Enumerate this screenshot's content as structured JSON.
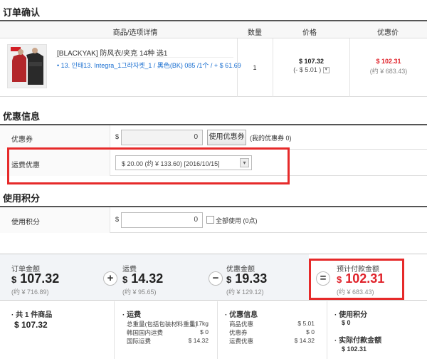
{
  "order": {
    "title": "订单确认",
    "headers": {
      "product": "商品/选项详情",
      "qty": "数量",
      "price": "价格",
      "discount_price": "优惠价"
    },
    "item": {
      "name": "[BLACKYAK] 防风衣/夹克 14种 选1",
      "option": "• 13. 인태13. Integra_1그라자켓_1 / 黑色(BK) 085 /1个 / + $ 61.69",
      "qty": "1",
      "price": "$ 107.32",
      "price_sub": "(- $ 5.01 )",
      "discount_price": "$ 102.31",
      "discount_sub": "(约 ¥ 683.43)"
    }
  },
  "promo": {
    "title": "优惠信息",
    "coupon_label": "优惠券",
    "coupon_currency": "$",
    "coupon_value": "0",
    "coupon_button": "使用优惠券",
    "my_coupons": "(我的优惠券 0)",
    "shipping_label": "运费优惠",
    "shipping_option": "$ 20.00 (约 ¥ 133.60) [2016/10/15]"
  },
  "points": {
    "title": "使用积分",
    "label": "使用积分",
    "currency": "$",
    "value": "0",
    "use_all": "全部使用",
    "points_info": "(0点)"
  },
  "summary": {
    "order_total_label": "订单金额",
    "order_total_cur": "$",
    "order_total": "107.32",
    "order_total_sub": "(约 ¥ 716.89)",
    "shipping_label": "运费",
    "shipping_cur": "$",
    "shipping": "14.32",
    "shipping_sub": "(约 ¥ 95.65)",
    "discount_label": "优惠金额",
    "discount_cur": "$",
    "discount": "19.33",
    "discount_sub": "(约 ¥ 129.12)",
    "pay_label": "预计付款金额",
    "pay_cur": "$",
    "pay": "102.31",
    "pay_sub": "(约 ¥ 683.43)",
    "plus": "+",
    "minus": "−",
    "equals": "="
  },
  "details": {
    "items_label": "· 共 1 件商品",
    "items_total": "$ 107.32",
    "ship_title": "· 运费",
    "ship_rows": [
      {
        "k": "总重量(包括包装材料重量)",
        "v": "1.17kg"
      },
      {
        "k": "韩国国内运费",
        "v": "$ 0"
      },
      {
        "k": "国际运费",
        "v": "$ 14.32"
      }
    ],
    "disc_title": "· 优惠信息",
    "disc_rows": [
      {
        "k": "商品优惠",
        "v": "$ 5.01"
      },
      {
        "k": "优惠券",
        "v": "$ 0"
      },
      {
        "k": "运费优惠",
        "v": "$ 14.32"
      }
    ],
    "pts_title": "· 使用积分",
    "pts_value": "$ 0",
    "actual_title": "· 实际付款金额",
    "actual_value": "$ 102.31"
  }
}
